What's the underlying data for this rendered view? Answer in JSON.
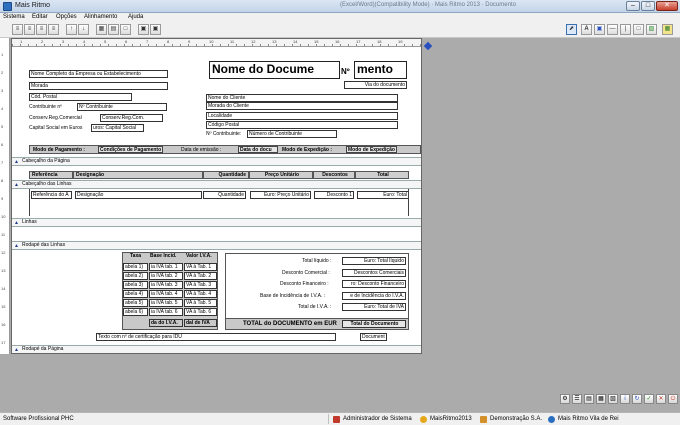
{
  "window": {
    "title": "Mais Ritmo",
    "ghost_title": "(Excel/Word)(Compatibility Mode) · Mais Ritmo 2013 · Documento",
    "min": "–",
    "max": "□",
    "close": "✕"
  },
  "menu": [
    "Sistema",
    "Editar",
    "Opções",
    "Alinhamento",
    "Ajuda"
  ],
  "toolbar_left": [
    "align-left",
    "align-center",
    "align-right",
    "align-justify",
    "arrow-up",
    "arrow-down",
    "group",
    "ungroup",
    "same-size",
    "bring-front",
    "send-back"
  ],
  "toolbar_right": [
    "pointer",
    "text",
    "image",
    "line",
    "vertical-line",
    "box",
    "barcode",
    "field"
  ],
  "ruler_h": [
    "1",
    "2",
    "3",
    "4",
    "5",
    "6",
    "7",
    "8",
    "9",
    "10",
    "11",
    "12",
    "13",
    "14",
    "15",
    "16",
    "17",
    "18",
    "19"
  ],
  "ruler_v": [
    "1",
    "2",
    "3",
    "4",
    "5",
    "6",
    "7",
    "8",
    "9",
    "10",
    "11",
    "12",
    "13",
    "14",
    "15",
    "16",
    "17"
  ],
  "header": {
    "company_name": "Nome Completo da Empresa ou Estabelecimento",
    "address": "Morada",
    "postal": "Cód. Postal",
    "taxpayer_label": "Contribuinte nº",
    "taxpayer_value": "Nº Contribuinte",
    "registry_label": "Conserv.Reg.Comercial",
    "registry_value": "Conserv.Reg.Com.",
    "capital_label": "Capital Social em Euros",
    "capital_value": "uros: Capital Social",
    "doc_name": "Nome do Docume",
    "doc_no_label": "Nº",
    "doc_no_value": "mento",
    "via": "Via do documento",
    "client_name": "Nome do Cliente",
    "client_address": "Morada do Cliente",
    "client_locality": "Localidade",
    "client_postal": "Código Postal",
    "client_taxpayer_label": "Nº Contribuinte:",
    "client_taxpayer_value": "Número de Contribuinte"
  },
  "terms_bar": {
    "payment_label": "Modo de Pagamento :",
    "payment_value": "Condições de Pagamento",
    "issue_label": "Data de emissão :",
    "issue_value": "Data do docu",
    "dispatch_label": "Modo de Expedição :",
    "dispatch_value": "Modo de Expedição"
  },
  "bands": {
    "page_header": "Cabeçalho da Página",
    "lines_header": "Cabeçalho das Linhas",
    "lines": "Linhas",
    "lines_footer": "Rodapé das Linhas",
    "page_footer": "Rodapé da Página"
  },
  "columns": {
    "ref": "Referência",
    "desc": "Designação",
    "qty": "Quantidade",
    "price": "Preço Unitário",
    "discounts": "Descontos",
    "total": "Total"
  },
  "line_fields": {
    "ref": "Referência do A",
    "desc": "Designação",
    "qty": "Quantidade",
    "price": "Euro: Preço Unitário",
    "discount": "Desconto 1",
    "total": "Euro: Total"
  },
  "tax_table": {
    "h_rate": "Taxa",
    "h_base": "Base Incid.",
    "h_value": "Valor I.V.A.",
    "rows": [
      [
        "abela 1)",
        "ia IVA tab. 1",
        "VA à Tab. 1"
      ],
      [
        "abela 2)",
        "ia IVA tab. 2",
        "VA à Tab. 2"
      ],
      [
        "abela 3)",
        "ia IVA tab. 3",
        "VA à Tab. 3"
      ],
      [
        "abela 4)",
        "ia IVA tab. 4",
        "VA à Tab. 4"
      ],
      [
        "abela 5)",
        "ia IVA tab. 5",
        "VA à Tab. 5"
      ],
      [
        "abela 6)",
        "ia IVA tab. 6",
        "VA à Tab. 6"
      ]
    ],
    "foot_base": "da do I.V.A.",
    "foot_value": "dal de IVA"
  },
  "totals": {
    "net_label": "Total líquido :",
    "net_value": "Euro: Total líquido",
    "comm_label": "Desconto Comercial :",
    "comm_value": "Descontos Comerciais",
    "fin_label": "Desconto Financeiro :",
    "fin_value": "ro: Desconto Financeiro",
    "base_label": "Base de Incidência de I.V.A. :",
    "base_value": "e de Incidência do I.V.A.",
    "vat_label": "Total de I.V.A. :",
    "vat_value": "Euro: Total de IVA",
    "doc_total_label": "TOTAL do DOCUMENTO em EUR",
    "doc_total_value": "Total do Documento"
  },
  "footer_fields": {
    "certification": "Texto com nº de certificação para IDU",
    "doc": "Document"
  },
  "status": {
    "product": "Software Profissional PHC",
    "user": "Administrador de Sistema",
    "app": "MaisRitmo2013",
    "company": "Demonstração S.A.",
    "site": "Mais Ritmo Vila de Rei"
  },
  "colors": {
    "accent": "#2a4fbf",
    "canvas": "#ababab",
    "header_fill": "#c9c9c9"
  }
}
